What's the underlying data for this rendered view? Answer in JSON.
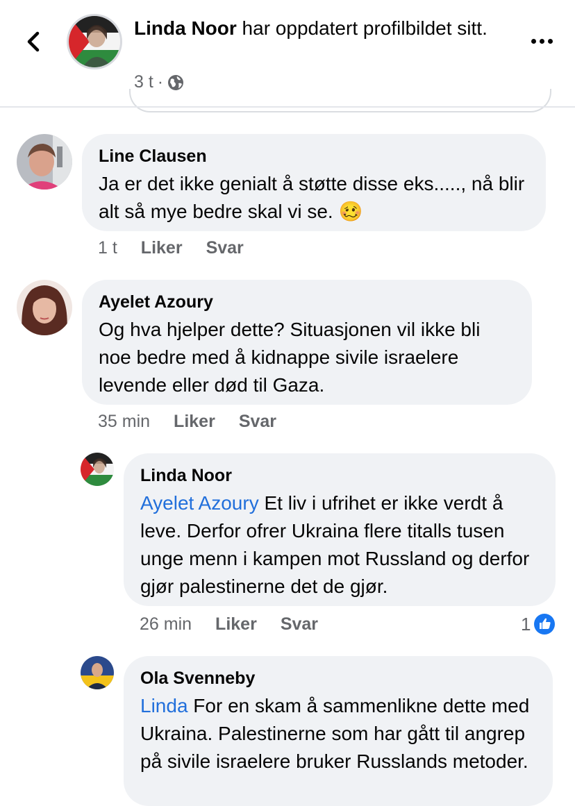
{
  "header": {
    "poster_name": "Linda Noor",
    "action_text": " har oppdatert profilbildet sitt.",
    "time": "3 t",
    "separator": "·",
    "icons": {
      "back": "chevron-left-icon",
      "privacy": "globe-icon",
      "more": "more-horizontal-icon"
    }
  },
  "comments": [
    {
      "author": "Line Clausen",
      "text": "Ja er det ikke genialt å støtte disse eks....., nå blir alt så mye bedre skal vi se.",
      "emoji": "🥴",
      "time": "1 t",
      "like_label": "Liker",
      "reply_label": "Svar"
    },
    {
      "author": "Ayelet Azoury",
      "text": "Og hva hjelper dette? Situasjonen vil ikke bli noe bedre med å kidnappe sivile israelere levende eller død til Gaza.",
      "time": "35 min",
      "like_label": "Liker",
      "reply_label": "Svar"
    }
  ],
  "replies": [
    {
      "author": "Linda Noor",
      "mention": "Ayelet Azoury",
      "text": " Et liv i ufrihet er ikke verdt å leve. Derfor ofrer Ukraina flere titalls tusen unge menn i kampen mot Russland og derfor gjør palestinerne det de gjør.",
      "time": "26 min",
      "like_label": "Liker",
      "reply_label": "Svar",
      "reaction_count": "1",
      "reaction_icon": "thumbs-up-icon"
    },
    {
      "author": "Ola Svenneby",
      "mention": "Linda",
      "text": " For en skam å sammenlikne dette med Ukraina. Palestinerne som har gått til angrep på sivile israelere bruker Russlands metoder."
    }
  ],
  "colors": {
    "bubble": "#f0f2f5",
    "mention": "#216fdb",
    "secondary_text": "#65676b",
    "like_blue": "#1877f2"
  }
}
